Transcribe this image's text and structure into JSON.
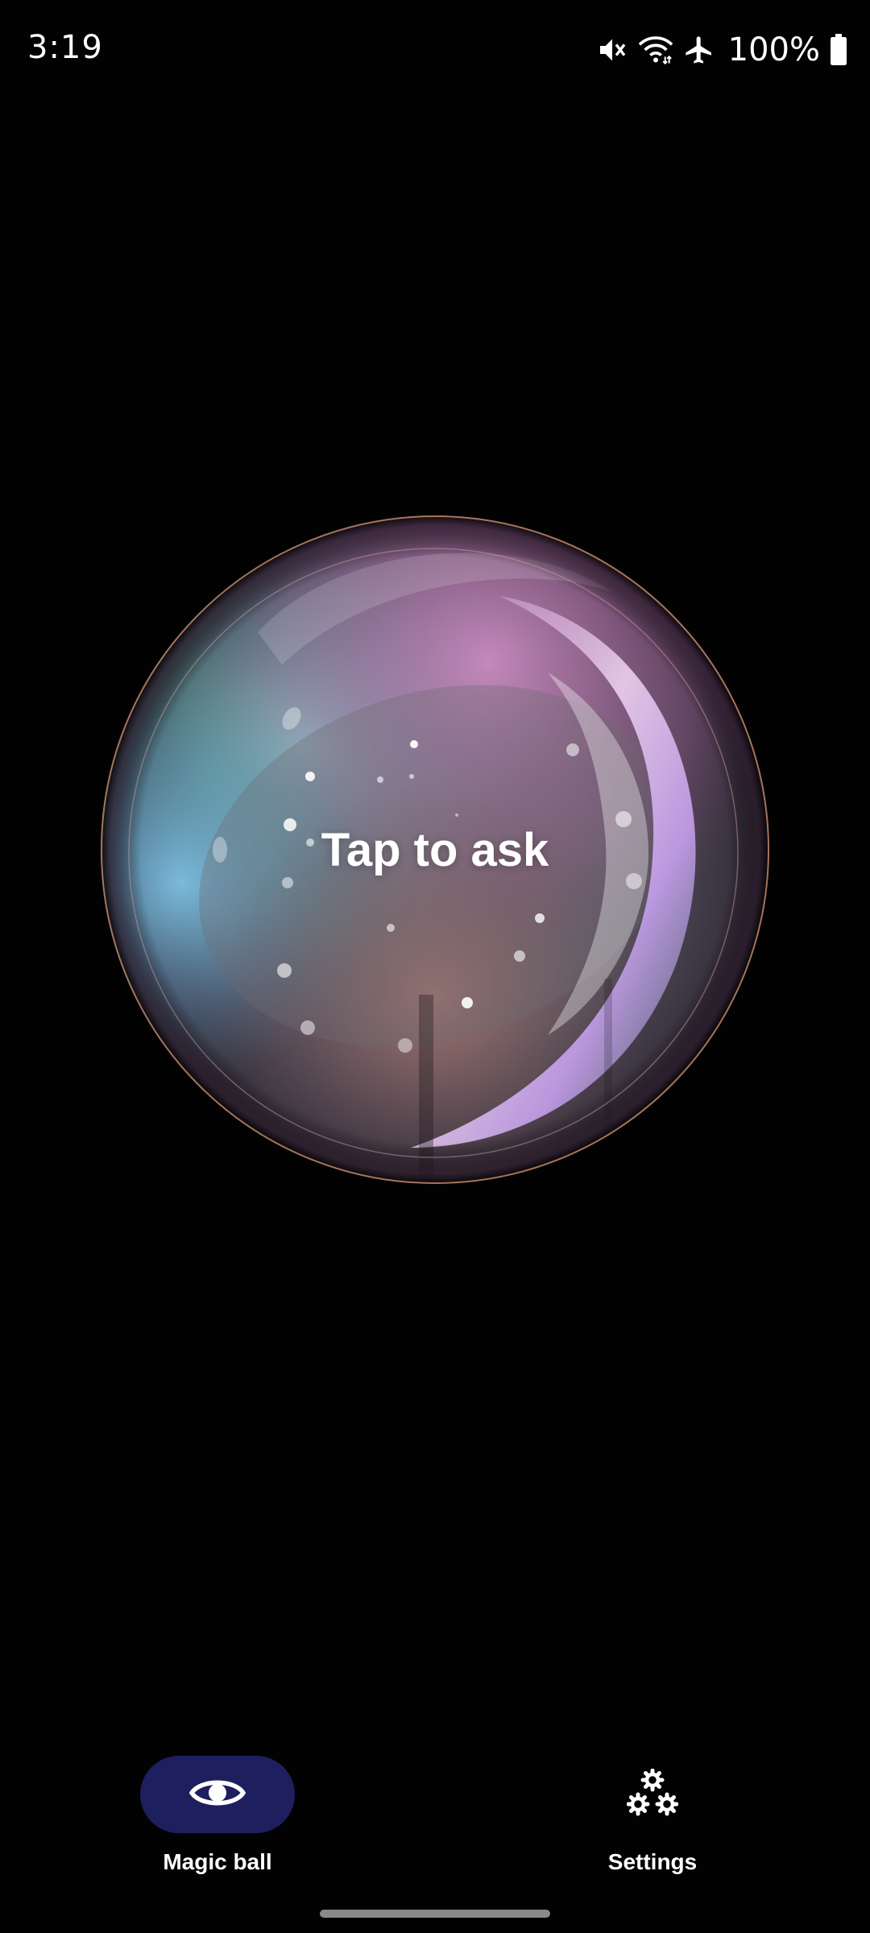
{
  "status_bar": {
    "time": "3:19",
    "battery": "100%",
    "icons": [
      "mute-icon",
      "wifi-icon",
      "airplane-icon",
      "battery-icon"
    ]
  },
  "orb": {
    "label": "Tap to ask"
  },
  "bottom_nav": {
    "items": [
      {
        "label": "Magic ball",
        "icon": "eye-icon",
        "active": true
      },
      {
        "label": "Settings",
        "icon": "gears-icon",
        "active": false
      }
    ]
  },
  "colors": {
    "background": "#030203",
    "active_pill": "#1e1f5e",
    "text": "#ffffff"
  }
}
